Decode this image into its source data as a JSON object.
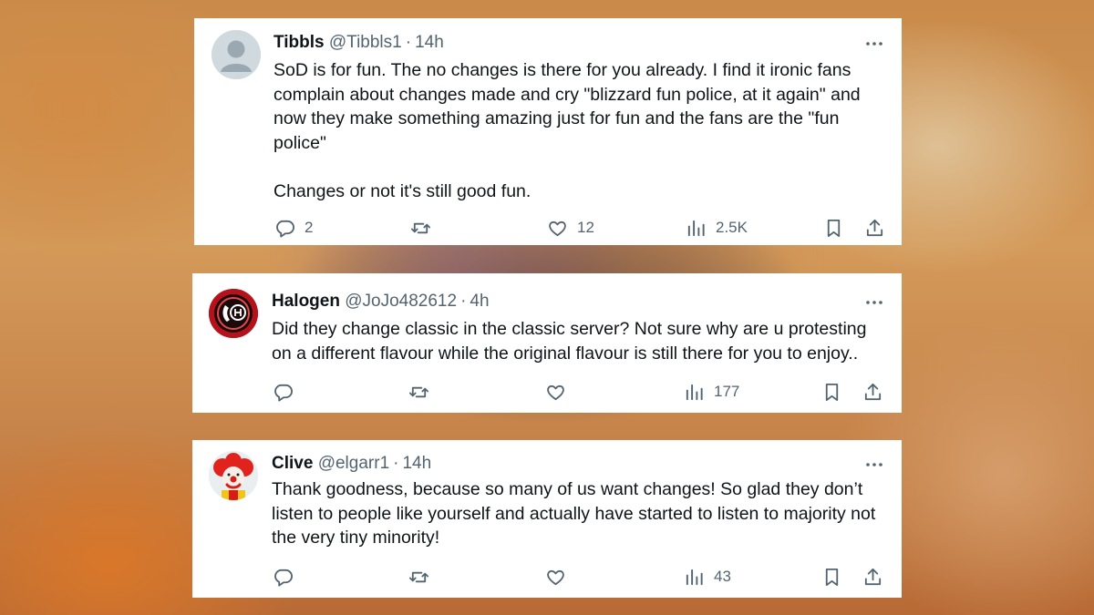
{
  "tweets": [
    {
      "name": "Tibbls",
      "handle": "@Tibbls1",
      "separator": "·",
      "time": "14h",
      "text": "SoD is for fun.  The no changes is there for you already.  I find it ironic fans complain about changes made and cry \"blizzard fun police, at it again\" and now they make something amazing just for fun and the fans are the \"fun police\"\n\nChanges or not it's still good fun.",
      "replies": "2",
      "reposts": "",
      "likes": "12",
      "views": "2.5K"
    },
    {
      "name": "Halogen",
      "handle": "@JoJo482612",
      "separator": "·",
      "time": "4h",
      "text": "Did they change classic in the classic server? Not sure why are u protesting on a different flavour while the original flavour is still there for you to enjoy..",
      "replies": "",
      "reposts": "",
      "likes": "",
      "views": "177"
    },
    {
      "name": "Clive",
      "handle": "@elgarr1",
      "separator": "·",
      "time": "14h",
      "text": "Thank goodness, because so many of us want changes! So glad they don’t listen to people like yourself and actually have started to listen to majority not the very tiny minority!",
      "replies": "",
      "reposts": "",
      "likes": "",
      "views": "43"
    }
  ],
  "icons": {
    "reply": "reply-icon",
    "repost": "repost-icon",
    "like": "like-icon",
    "views": "views-icon",
    "bookmark": "bookmark-icon",
    "share": "share-icon",
    "more": "more-icon"
  },
  "colors": {
    "text_primary": "#0f1419",
    "text_secondary": "#536471",
    "card_bg": "#ffffff"
  }
}
